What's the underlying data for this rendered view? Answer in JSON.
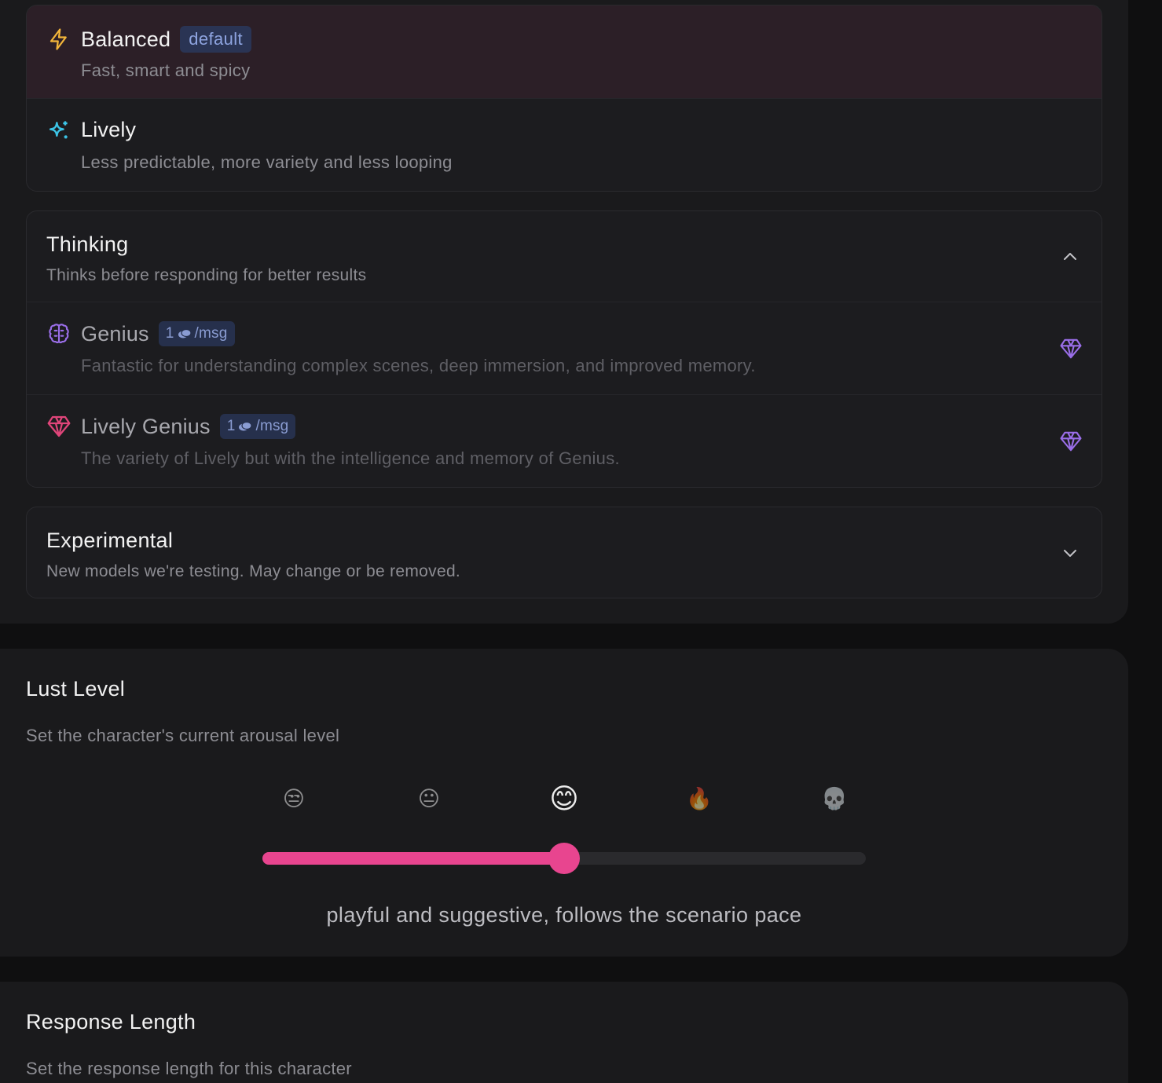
{
  "models": {
    "basic": [
      {
        "name": "Balanced",
        "badge": "default",
        "desc": "Fast, smart and spicy",
        "icon": "bolt-icon",
        "selected": true
      },
      {
        "name": "Lively",
        "desc": "Less predictable, more variety and less looping",
        "icon": "sparkles-icon",
        "selected": false
      }
    ],
    "thinking": {
      "title": "Thinking",
      "desc": "Thinks before responding for better results",
      "expanded": true,
      "items": [
        {
          "name": "Genius",
          "cost_amount": "1",
          "cost_unit": "/msg",
          "desc": "Fantastic for understanding complex scenes, deep immersion, and improved memory.",
          "icon": "brain-icon"
        },
        {
          "name": "Lively Genius",
          "cost_amount": "1",
          "cost_unit": "/msg",
          "desc": "The variety of Lively but with the intelligence and memory of Genius.",
          "icon": "gem-icon"
        }
      ]
    },
    "experimental": {
      "title": "Experimental",
      "desc": "New models we're testing. May change or be removed.",
      "expanded": false
    }
  },
  "lust": {
    "title": "Lust Level",
    "desc": "Set the character's current arousal level",
    "levels": [
      "😒",
      "😐",
      "😊",
      "🔥",
      "💀"
    ],
    "selected_index": 2,
    "value_fraction": 0.5,
    "level_text": "playful and suggestive, follows the scenario pace"
  },
  "response_length": {
    "title": "Response Length",
    "desc": "Set the response length for this character"
  },
  "colors": {
    "accent": "#e8458f",
    "selected_row": "#2c1f27",
    "badge_bg": "#2a3454",
    "badge_text": "#8ea4e0",
    "bolt": "#f2b53a",
    "sparkle": "#3cc4e6",
    "brain": "#9a6ee8",
    "gem_pink": "#e0457a",
    "gem_purple": "#9a6ee8"
  }
}
